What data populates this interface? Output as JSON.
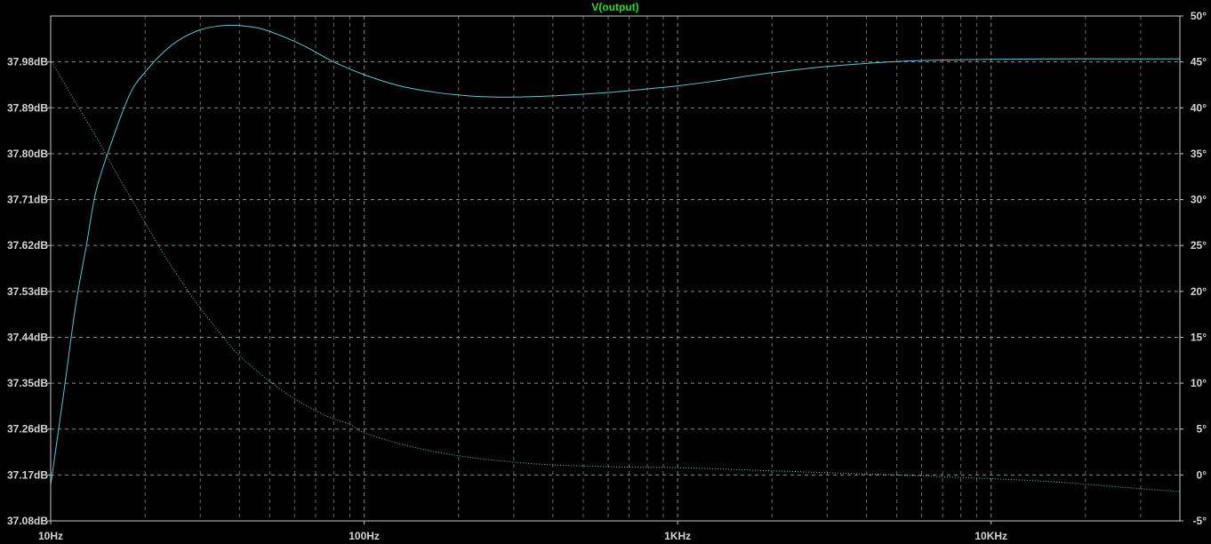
{
  "colors": {
    "background": "#000000",
    "frame": "#c8c8c8",
    "grid": "#8a8a8a",
    "axis_text": "#d4d4d4",
    "title": "#22e022",
    "trace": "#5fc4d4"
  },
  "chart_data": {
    "type": "line",
    "title": "V(output)",
    "xscale": "log",
    "xlim": [
      10,
      40000
    ],
    "xticks": [
      10,
      100,
      1000,
      10000
    ],
    "xtick_labels": [
      "10Hz",
      "100Hz",
      "1KHz",
      "10KHz"
    ],
    "y_left": {
      "lim": [
        37.08,
        38.07
      ],
      "ticks": [
        37.08,
        37.17,
        37.26,
        37.35,
        37.44,
        37.53,
        37.62,
        37.71,
        37.8,
        37.89,
        37.98
      ],
      "tick_labels": [
        "37.08dB",
        "37.17dB",
        "37.26dB",
        "37.35dB",
        "37.44dB",
        "37.53dB",
        "37.62dB",
        "37.71dB",
        "37.80dB",
        "37.89dB",
        "37.98dB"
      ]
    },
    "y_right": {
      "lim": [
        -5,
        50
      ],
      "ticks": [
        -5,
        0,
        5,
        10,
        15,
        20,
        25,
        30,
        35,
        40,
        45,
        50
      ],
      "tick_labels": [
        "-5°",
        "0°",
        "5°",
        "10°",
        "15°",
        "20°",
        "25°",
        "30°",
        "35°",
        "40°",
        "45°",
        "50°"
      ]
    },
    "grid": true,
    "series": [
      {
        "axis": "left",
        "style": "solid",
        "x": [
          10,
          11,
          12,
          13,
          14,
          16,
          18,
          20,
          23,
          26,
          30,
          34,
          38,
          42,
          47,
          55,
          65,
          80,
          100,
          130,
          170,
          220,
          280,
          350,
          450,
          600,
          800,
          1000,
          1300,
          1700,
          2200,
          3000,
          4000,
          5500,
          7500,
          10000,
          15000,
          25000,
          40000
        ],
        "y": [
          37.15,
          37.33,
          37.5,
          37.62,
          37.73,
          37.84,
          37.92,
          37.96,
          38.0,
          38.025,
          38.043,
          38.05,
          38.052,
          38.05,
          38.045,
          38.03,
          38.01,
          37.98,
          37.955,
          37.933,
          37.92,
          37.913,
          37.911,
          37.912,
          37.915,
          37.92,
          37.927,
          37.933,
          37.942,
          37.953,
          37.962,
          37.971,
          37.977,
          37.982,
          37.984,
          37.985,
          37.986,
          37.986,
          37.986
        ]
      },
      {
        "axis": "right",
        "style": "dotted",
        "x": [
          10,
          11,
          12,
          14,
          16,
          18,
          20,
          23,
          26,
          30,
          35,
          40,
          50,
          60,
          75,
          90,
          100,
          130,
          170,
          220,
          300,
          400,
          550,
          700,
          1000,
          1500,
          2000,
          3000,
          5000,
          7000,
          10000,
          15000,
          20000,
          30000,
          40000
        ],
        "y": [
          45.2,
          42.8,
          40.6,
          36.8,
          33.2,
          30.2,
          27.5,
          24.0,
          21.2,
          18.2,
          15.3,
          13.0,
          10.2,
          8.3,
          6.5,
          5.5,
          4.6,
          3.4,
          2.5,
          1.9,
          1.4,
          1.1,
          0.95,
          0.85,
          0.8,
          0.6,
          0.45,
          0.25,
          0.0,
          -0.2,
          -0.4,
          -0.7,
          -1.0,
          -1.5,
          -1.8
        ]
      }
    ]
  }
}
